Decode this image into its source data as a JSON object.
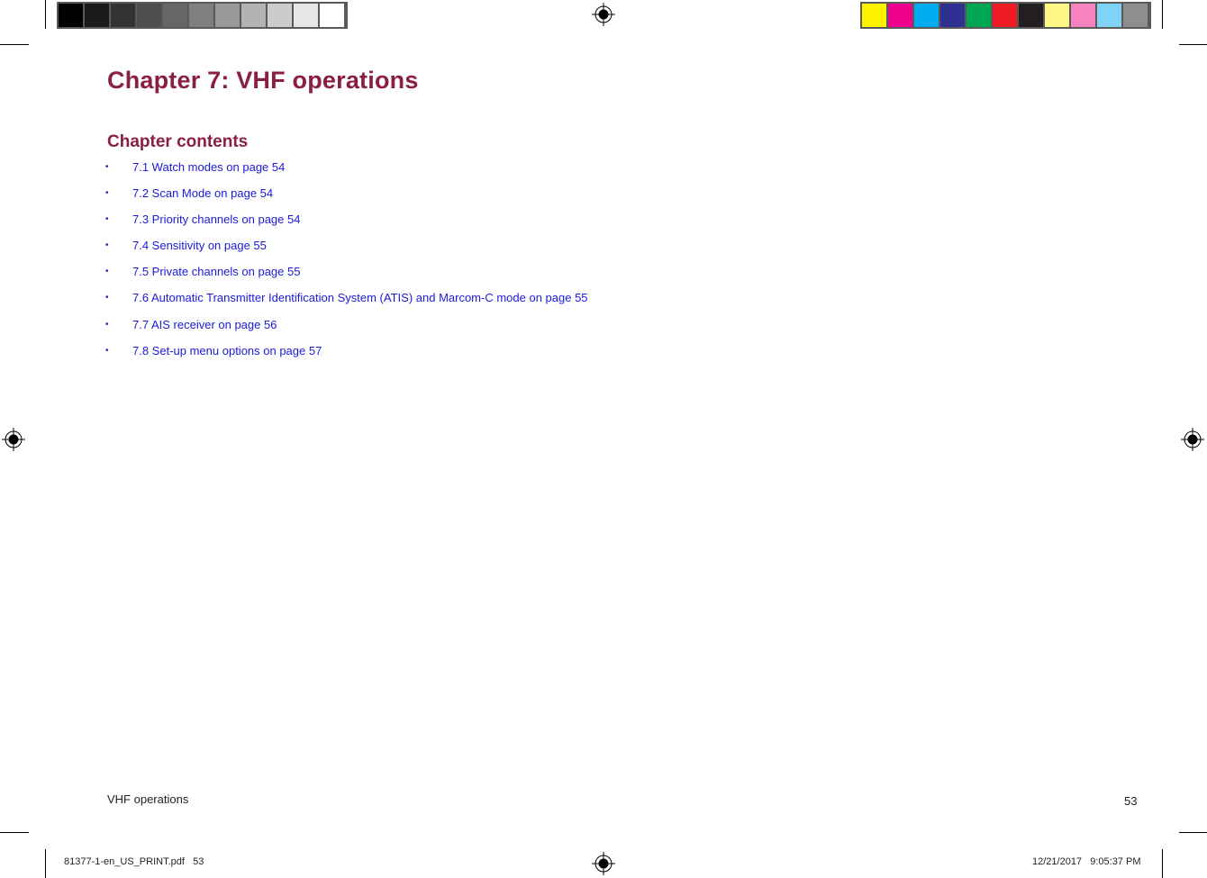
{
  "printer_marks": {
    "grayscale_bar": [
      "#000000",
      "#1a1a1a",
      "#333333",
      "#4d4d4d",
      "#666666",
      "#808080",
      "#999999",
      "#b3b3b3",
      "#cccccc",
      "#e6e6e6",
      "#ffffff"
    ],
    "color_bar": [
      "#fff200",
      "#ec008c",
      "#00aeef",
      "#2e3192",
      "#00a651",
      "#ed1c24",
      "#231f20",
      "#fff685",
      "#f682c0",
      "#7fd3f7",
      "#8f8d8e"
    ]
  },
  "page": {
    "chapter_title": "Chapter 7: VHF operations",
    "contents_heading": "Chapter contents",
    "toc": [
      {
        "bullet": "•",
        "text": "7.1 Watch modes on page 54"
      },
      {
        "bullet": "•",
        "text": "7.2 Scan Mode on page 54"
      },
      {
        "bullet": "•",
        "text": "7.3 Priority channels on page 54"
      },
      {
        "bullet": "•",
        "text": "7.4 Sensitivity on page 55"
      },
      {
        "bullet": "•",
        "text": "7.5 Private channels on page 55"
      },
      {
        "bullet": "•",
        "text": "7.6 Automatic Transmitter Identification System (ATIS) and Marcom-C mode on page 55"
      },
      {
        "bullet": "•",
        "text": "7.7 AIS receiver on page 56"
      },
      {
        "bullet": "•",
        "text": "7.8 Set-up menu options on page 57"
      }
    ],
    "footer": {
      "section": "VHF operations",
      "page_number": "53"
    }
  },
  "slug": {
    "file": "81377-1-en_US_PRINT.pdf   53",
    "timestamp": "12/21/2017   9:05:37 PM"
  },
  "colors": {
    "heading": "#8b1e45",
    "link": "#1a1adb",
    "body": "#231f20"
  }
}
